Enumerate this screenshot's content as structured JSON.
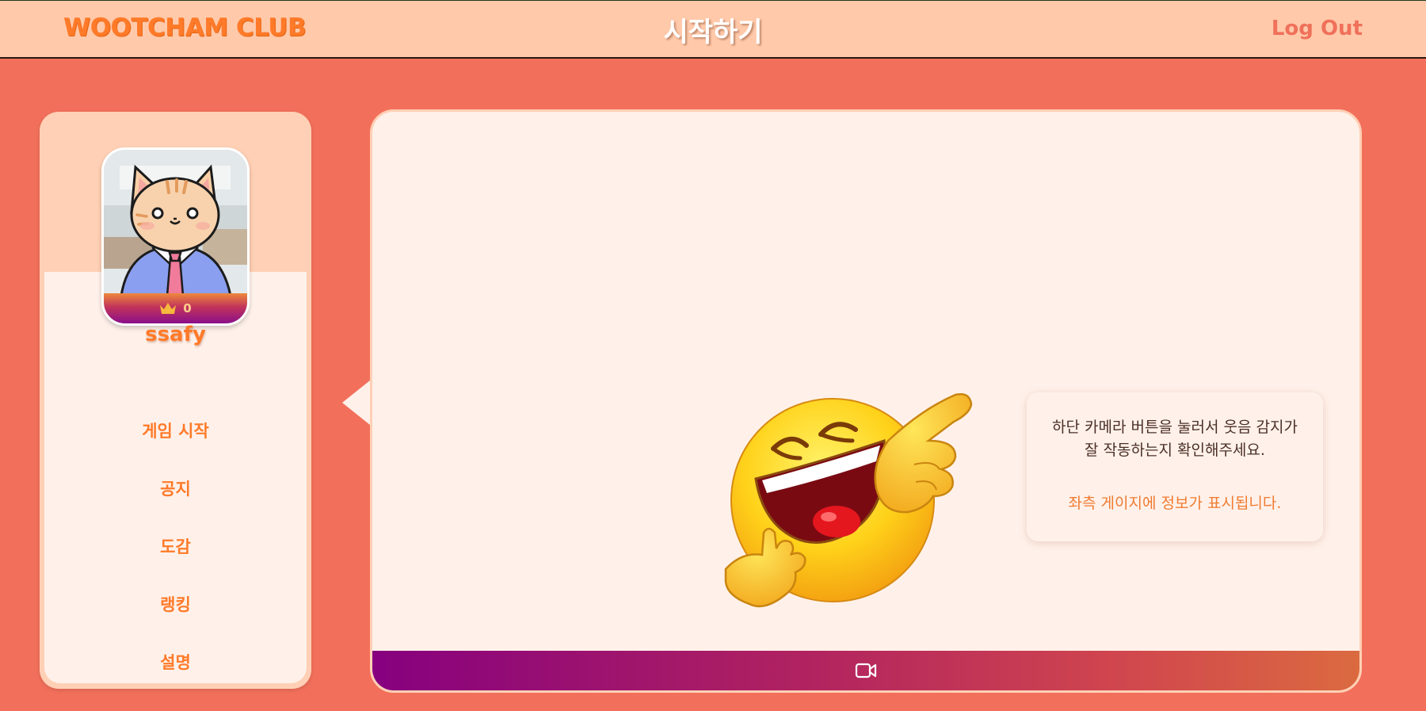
{
  "header": {
    "brand": "WOOTCHAM CLUB",
    "title": "시작하기",
    "logout_label": "Log Out"
  },
  "profile": {
    "avatar_icon": "cat-avatar-icon",
    "score": "0",
    "username": "ssafy"
  },
  "sidebar": {
    "items": [
      {
        "label": "게임 시작"
      },
      {
        "label": "공지"
      },
      {
        "label": "도감"
      },
      {
        "label": "랭킹"
      },
      {
        "label": "설명"
      }
    ]
  },
  "main": {
    "hint_text": "하단 카메라 버튼을 눌러서 웃음 감지가 잘 작동하는지 확인해주세요.",
    "hint_note": "좌측 게이지에 정보가 표시됩니다.",
    "camera_icon": "video-camera-icon"
  },
  "colors": {
    "background": "#f2705b",
    "header": "#ffc9aa",
    "accent": "#ff7a29",
    "panel": "#fff1ea",
    "gradient_start": "#86007f",
    "gradient_end": "#db6a40"
  }
}
